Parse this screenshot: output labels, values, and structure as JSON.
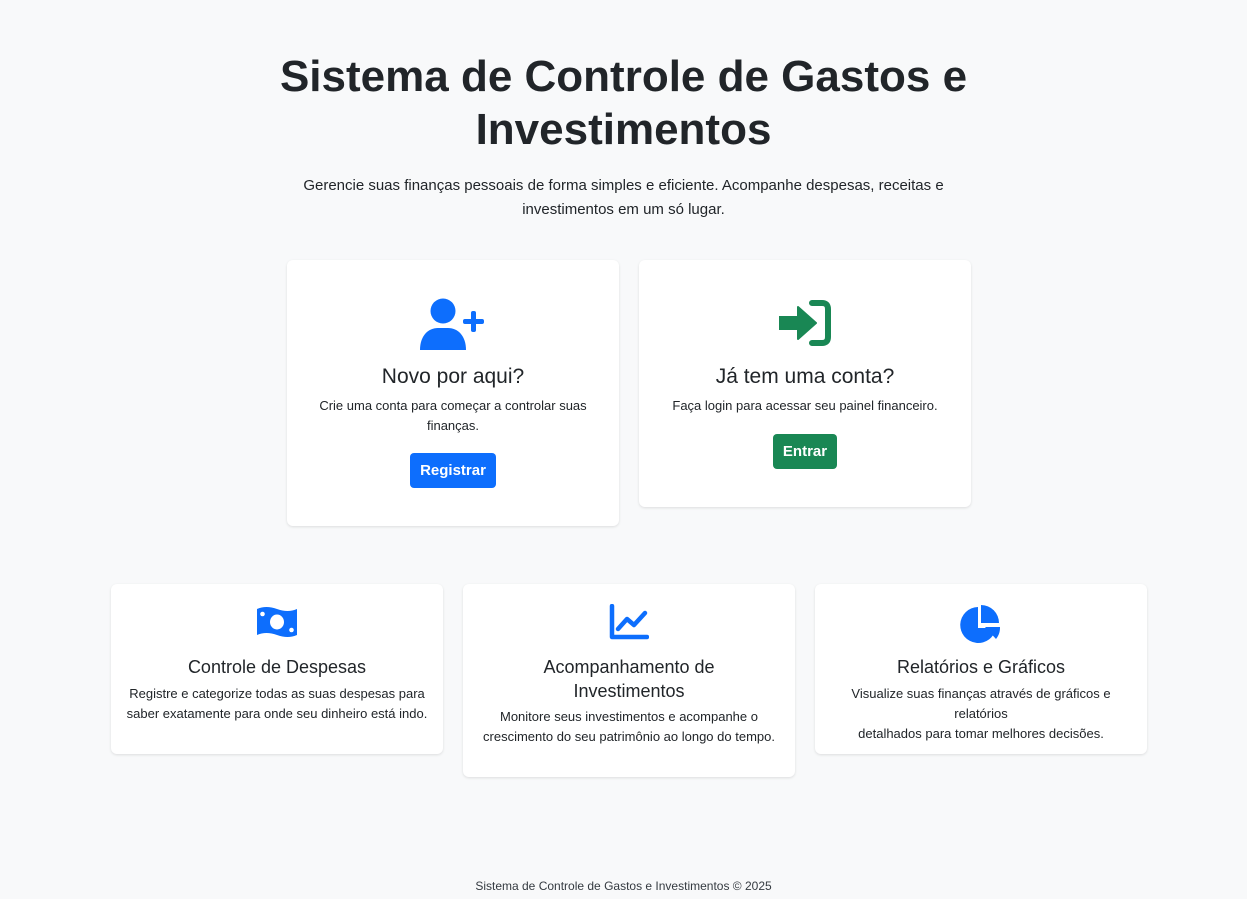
{
  "hero": {
    "title_line1": "Sistema de Controle de Gastos e",
    "title_line2": "Investimentos",
    "lead_line1": "Gerencie suas finanças pessoais de forma simples e eficiente. Acompanhe despesas, receitas e",
    "lead_line2": "investimentos em um só lugar."
  },
  "register_card": {
    "icon": "user-plus-icon",
    "title": "Novo por aqui?",
    "text_line1": "Crie uma conta para começar a controlar suas",
    "text_line2": "finanças.",
    "button": "Registrar"
  },
  "login_card": {
    "icon": "sign-in-icon",
    "title": "Já tem uma conta?",
    "text": "Faça login para acessar seu painel financeiro.",
    "button": "Entrar"
  },
  "features": [
    {
      "icon": "money-bill-icon",
      "title": "Controle de Despesas",
      "text_line1": "Registre e categorize todas as suas despesas para",
      "text_line2": "saber exatamente para onde seu dinheiro está indo."
    },
    {
      "icon": "line-chart-icon",
      "title_line1": "Acompanhamento de",
      "title_line2": "Investimentos",
      "text_line1": "Monitore seus investimentos e acompanhe o",
      "text_line2": "crescimento do seu patrimônio ao longo do tempo."
    },
    {
      "icon": "pie-chart-icon",
      "title": "Relatórios e Gráficos",
      "text_line1": "Visualize suas finanças através de gráficos e relatórios",
      "text_line2": "detalhados para tomar melhores decisões."
    }
  ],
  "footer": "Sistema de Controle de Gastos e Investimentos © 2025",
  "colors": {
    "primary": "#0d6efd",
    "success": "#198754",
    "background": "#f8f9fa",
    "text": "#212529"
  }
}
